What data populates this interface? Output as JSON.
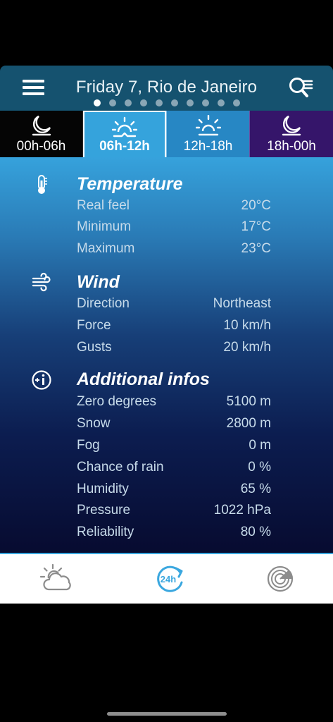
{
  "header": {
    "title": "Friday 7, Rio de Janeiro",
    "menu_icon": "hamburger-menu-icon",
    "search_icon": "location-search-icon",
    "page_count": 10,
    "active_page": 0
  },
  "tabs": [
    {
      "label": "00h-06h",
      "icon": "moon-icon"
    },
    {
      "label": "06h-12h",
      "icon": "sunrise-icon",
      "selected": true
    },
    {
      "label": "12h-18h",
      "icon": "sun-icon"
    },
    {
      "label": "18h-00h",
      "icon": "moon-icon"
    }
  ],
  "sections": {
    "temperature": {
      "title": "Temperature",
      "icon": "thermometer-icon",
      "rows": [
        {
          "label": "Real feel",
          "value": "20°C"
        },
        {
          "label": "Minimum",
          "value": "17°C"
        },
        {
          "label": "Maximum",
          "value": "23°C"
        }
      ]
    },
    "wind": {
      "title": "Wind",
      "icon": "wind-icon",
      "rows": [
        {
          "label": "Direction",
          "value": "Northeast"
        },
        {
          "label": "Force",
          "value": "10 km/h"
        },
        {
          "label": "Gusts",
          "value": "20 km/h"
        }
      ]
    },
    "additional": {
      "title": "Additional infos",
      "icon": "info-plus-icon",
      "rows": [
        {
          "label": "Zero degrees",
          "value": "5100 m"
        },
        {
          "label": "Snow",
          "value": "2800 m"
        },
        {
          "label": "Fog",
          "value": "0 m"
        },
        {
          "label": "Chance of rain",
          "value": "0 %"
        },
        {
          "label": "Humidity",
          "value": "65 %"
        },
        {
          "label": "Pressure",
          "value": "1022 hPa"
        },
        {
          "label": "Reliability",
          "value": "80 %"
        }
      ]
    }
  },
  "bottom_nav": {
    "items": [
      {
        "icon": "partly-cloudy-icon"
      },
      {
        "icon": "24h-refresh-icon",
        "label": "24h",
        "selected": true
      },
      {
        "icon": "radar-icon"
      }
    ]
  },
  "colors": {
    "header_bg": "#15526f",
    "selected_tab_bg": "#35a3dc",
    "accent": "#3aa7df",
    "night_tab_bg": "#35156a",
    "bottom_nav_inactive": "#8c8c8c"
  }
}
